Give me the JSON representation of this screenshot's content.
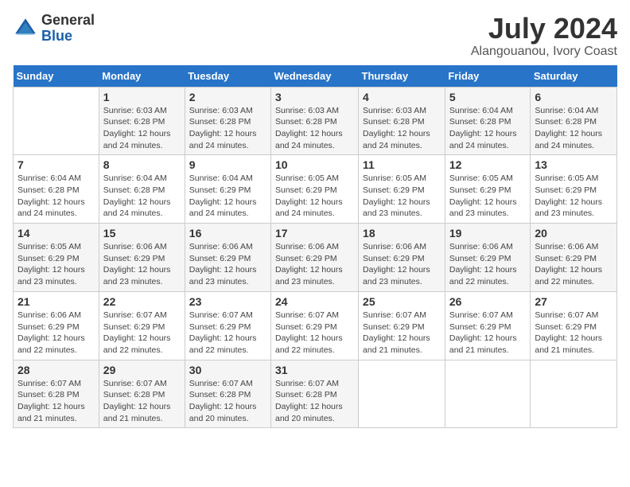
{
  "logo": {
    "general": "General",
    "blue": "Blue"
  },
  "title": {
    "month_year": "July 2024",
    "location": "Alangouanou, Ivory Coast"
  },
  "weekdays": [
    "Sunday",
    "Monday",
    "Tuesday",
    "Wednesday",
    "Thursday",
    "Friday",
    "Saturday"
  ],
  "weeks": [
    [
      {
        "day": "",
        "info": ""
      },
      {
        "day": "1",
        "info": "Sunrise: 6:03 AM\nSunset: 6:28 PM\nDaylight: 12 hours\nand 24 minutes."
      },
      {
        "day": "2",
        "info": "Sunrise: 6:03 AM\nSunset: 6:28 PM\nDaylight: 12 hours\nand 24 minutes."
      },
      {
        "day": "3",
        "info": "Sunrise: 6:03 AM\nSunset: 6:28 PM\nDaylight: 12 hours\nand 24 minutes."
      },
      {
        "day": "4",
        "info": "Sunrise: 6:03 AM\nSunset: 6:28 PM\nDaylight: 12 hours\nand 24 minutes."
      },
      {
        "day": "5",
        "info": "Sunrise: 6:04 AM\nSunset: 6:28 PM\nDaylight: 12 hours\nand 24 minutes."
      },
      {
        "day": "6",
        "info": "Sunrise: 6:04 AM\nSunset: 6:28 PM\nDaylight: 12 hours\nand 24 minutes."
      }
    ],
    [
      {
        "day": "7",
        "info": "Sunrise: 6:04 AM\nSunset: 6:28 PM\nDaylight: 12 hours\nand 24 minutes."
      },
      {
        "day": "8",
        "info": "Sunrise: 6:04 AM\nSunset: 6:28 PM\nDaylight: 12 hours\nand 24 minutes."
      },
      {
        "day": "9",
        "info": "Sunrise: 6:04 AM\nSunset: 6:29 PM\nDaylight: 12 hours\nand 24 minutes."
      },
      {
        "day": "10",
        "info": "Sunrise: 6:05 AM\nSunset: 6:29 PM\nDaylight: 12 hours\nand 24 minutes."
      },
      {
        "day": "11",
        "info": "Sunrise: 6:05 AM\nSunset: 6:29 PM\nDaylight: 12 hours\nand 23 minutes."
      },
      {
        "day": "12",
        "info": "Sunrise: 6:05 AM\nSunset: 6:29 PM\nDaylight: 12 hours\nand 23 minutes."
      },
      {
        "day": "13",
        "info": "Sunrise: 6:05 AM\nSunset: 6:29 PM\nDaylight: 12 hours\nand 23 minutes."
      }
    ],
    [
      {
        "day": "14",
        "info": "Sunrise: 6:05 AM\nSunset: 6:29 PM\nDaylight: 12 hours\nand 23 minutes."
      },
      {
        "day": "15",
        "info": "Sunrise: 6:06 AM\nSunset: 6:29 PM\nDaylight: 12 hours\nand 23 minutes."
      },
      {
        "day": "16",
        "info": "Sunrise: 6:06 AM\nSunset: 6:29 PM\nDaylight: 12 hours\nand 23 minutes."
      },
      {
        "day": "17",
        "info": "Sunrise: 6:06 AM\nSunset: 6:29 PM\nDaylight: 12 hours\nand 23 minutes."
      },
      {
        "day": "18",
        "info": "Sunrise: 6:06 AM\nSunset: 6:29 PM\nDaylight: 12 hours\nand 23 minutes."
      },
      {
        "day": "19",
        "info": "Sunrise: 6:06 AM\nSunset: 6:29 PM\nDaylight: 12 hours\nand 22 minutes."
      },
      {
        "day": "20",
        "info": "Sunrise: 6:06 AM\nSunset: 6:29 PM\nDaylight: 12 hours\nand 22 minutes."
      }
    ],
    [
      {
        "day": "21",
        "info": "Sunrise: 6:06 AM\nSunset: 6:29 PM\nDaylight: 12 hours\nand 22 minutes."
      },
      {
        "day": "22",
        "info": "Sunrise: 6:07 AM\nSunset: 6:29 PM\nDaylight: 12 hours\nand 22 minutes."
      },
      {
        "day": "23",
        "info": "Sunrise: 6:07 AM\nSunset: 6:29 PM\nDaylight: 12 hours\nand 22 minutes."
      },
      {
        "day": "24",
        "info": "Sunrise: 6:07 AM\nSunset: 6:29 PM\nDaylight: 12 hours\nand 22 minutes."
      },
      {
        "day": "25",
        "info": "Sunrise: 6:07 AM\nSunset: 6:29 PM\nDaylight: 12 hours\nand 21 minutes."
      },
      {
        "day": "26",
        "info": "Sunrise: 6:07 AM\nSunset: 6:29 PM\nDaylight: 12 hours\nand 21 minutes."
      },
      {
        "day": "27",
        "info": "Sunrise: 6:07 AM\nSunset: 6:29 PM\nDaylight: 12 hours\nand 21 minutes."
      }
    ],
    [
      {
        "day": "28",
        "info": "Sunrise: 6:07 AM\nSunset: 6:28 PM\nDaylight: 12 hours\nand 21 minutes."
      },
      {
        "day": "29",
        "info": "Sunrise: 6:07 AM\nSunset: 6:28 PM\nDaylight: 12 hours\nand 21 minutes."
      },
      {
        "day": "30",
        "info": "Sunrise: 6:07 AM\nSunset: 6:28 PM\nDaylight: 12 hours\nand 20 minutes."
      },
      {
        "day": "31",
        "info": "Sunrise: 6:07 AM\nSunset: 6:28 PM\nDaylight: 12 hours\nand 20 minutes."
      },
      {
        "day": "",
        "info": ""
      },
      {
        "day": "",
        "info": ""
      },
      {
        "day": "",
        "info": ""
      }
    ]
  ]
}
